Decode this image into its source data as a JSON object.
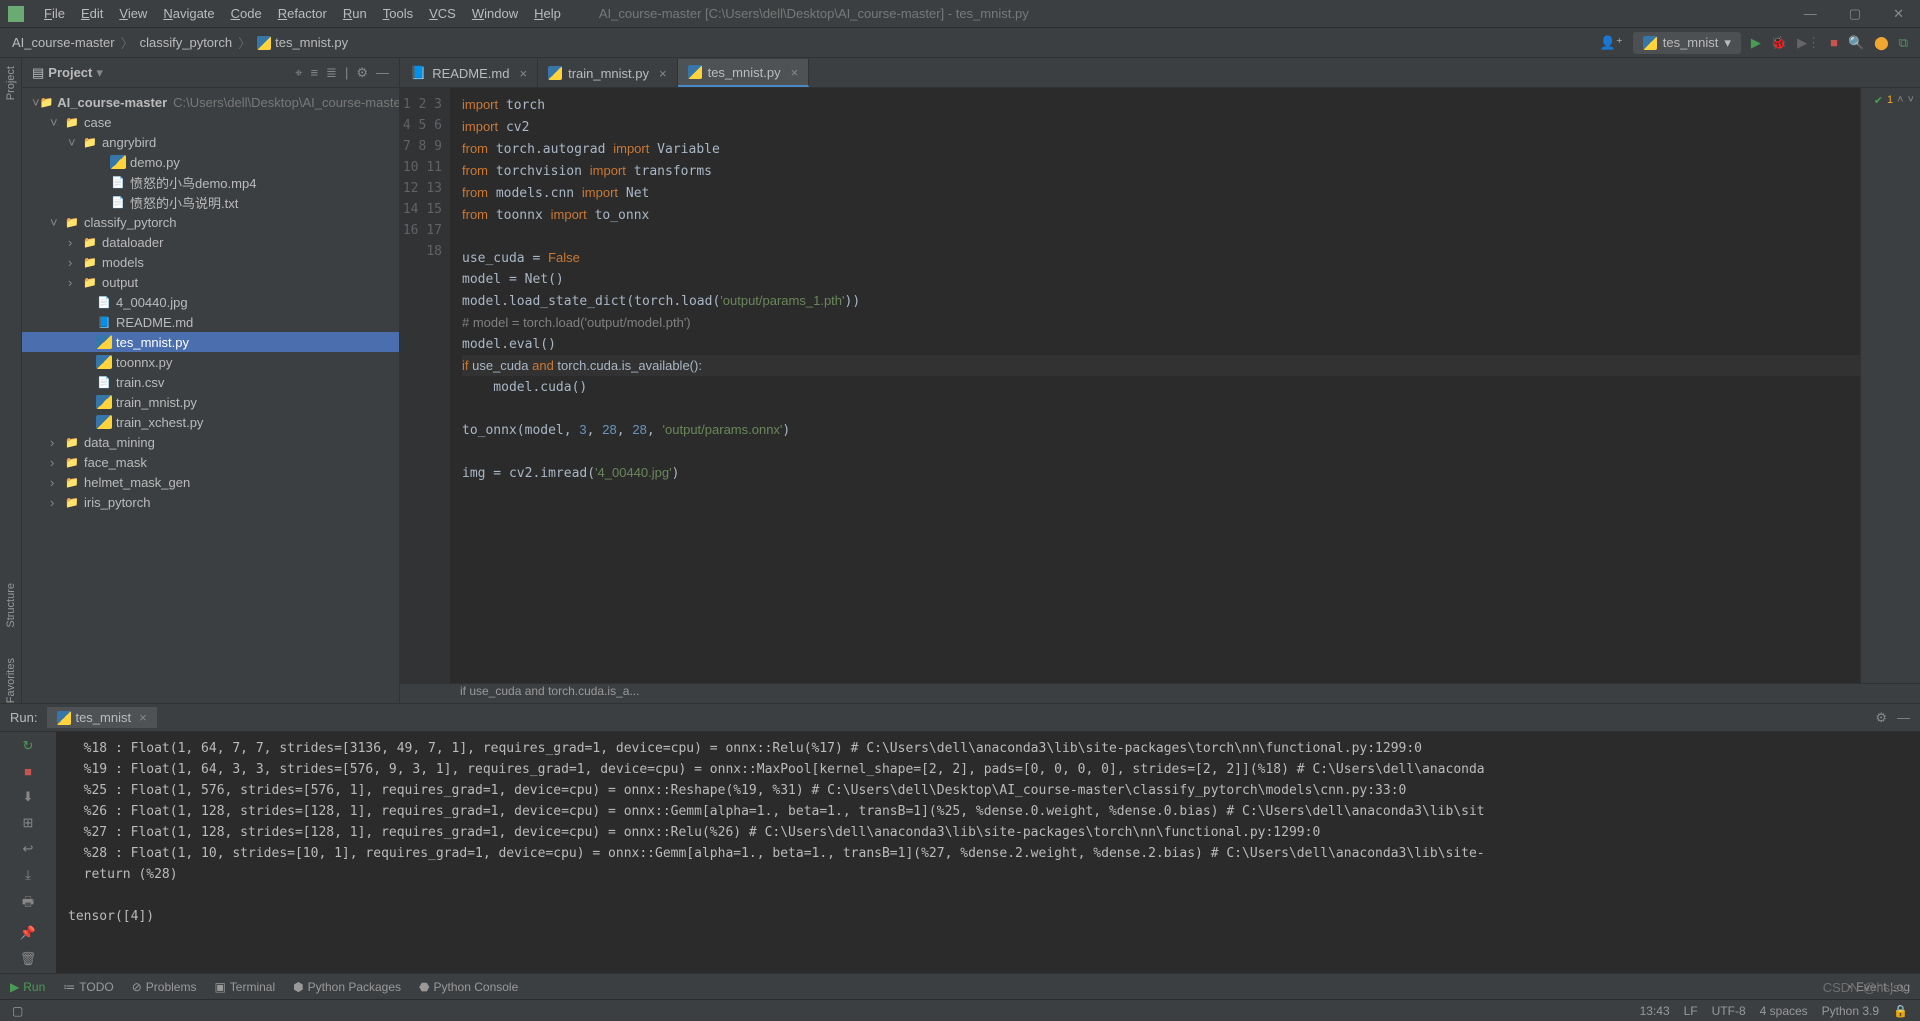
{
  "window": {
    "title_path": "AI_course-master [C:\\Users\\dell\\Desktop\\AI_course-master] - tes_mnist.py"
  },
  "menu": [
    "File",
    "Edit",
    "View",
    "Navigate",
    "Code",
    "Refactor",
    "Run",
    "Tools",
    "VCS",
    "Window",
    "Help"
  ],
  "breadcrumbs": [
    "AI_course-master",
    "classify_pytorch",
    "tes_mnist.py"
  ],
  "run_config": "tes_mnist",
  "project": {
    "title": "Project",
    "root_name": "AI_course-master",
    "root_path": "C:\\Users\\dell\\Desktop\\AI_course-master",
    "tree": [
      {
        "ind": 28,
        "tg": "˅",
        "ico": "fold",
        "label": "case"
      },
      {
        "ind": 46,
        "tg": "˅",
        "ico": "fold",
        "label": "angrybird"
      },
      {
        "ind": 74,
        "tg": "",
        "ico": "py",
        "label": "demo.py"
      },
      {
        "ind": 74,
        "tg": "",
        "ico": "file",
        "label": "愤怒的小鸟demo.mp4"
      },
      {
        "ind": 74,
        "tg": "",
        "ico": "file",
        "label": "愤怒的小鸟说明.txt"
      },
      {
        "ind": 28,
        "tg": "˅",
        "ico": "fold",
        "label": "classify_pytorch"
      },
      {
        "ind": 46,
        "tg": "›",
        "ico": "fold",
        "label": "dataloader"
      },
      {
        "ind": 46,
        "tg": "›",
        "ico": "fold",
        "label": "models"
      },
      {
        "ind": 46,
        "tg": "›",
        "ico": "fold",
        "label": "output"
      },
      {
        "ind": 60,
        "tg": "",
        "ico": "file",
        "label": "4_00440.jpg"
      },
      {
        "ind": 60,
        "tg": "",
        "ico": "md",
        "label": "README.md"
      },
      {
        "ind": 60,
        "tg": "",
        "ico": "py",
        "label": "tes_mnist.py",
        "sel": true
      },
      {
        "ind": 60,
        "tg": "",
        "ico": "py",
        "label": "toonnx.py"
      },
      {
        "ind": 60,
        "tg": "",
        "ico": "file",
        "label": "train.csv"
      },
      {
        "ind": 60,
        "tg": "",
        "ico": "py",
        "label": "train_mnist.py"
      },
      {
        "ind": 60,
        "tg": "",
        "ico": "py",
        "label": "train_xchest.py"
      },
      {
        "ind": 28,
        "tg": "›",
        "ico": "fold",
        "label": "data_mining"
      },
      {
        "ind": 28,
        "tg": "›",
        "ico": "fold",
        "label": "face_mask"
      },
      {
        "ind": 28,
        "tg": "›",
        "ico": "fold",
        "label": "helmet_mask_gen"
      },
      {
        "ind": 28,
        "tg": "›",
        "ico": "fold",
        "label": "iris_pytorch"
      }
    ]
  },
  "tabs": [
    {
      "label": "README.md",
      "ico": "md",
      "active": false
    },
    {
      "label": "train_mnist.py",
      "ico": "py",
      "active": false
    },
    {
      "label": "tes_mnist.py",
      "ico": "py",
      "active": true
    }
  ],
  "code_lines": [
    {
      "n": 1,
      "html": "<span class='kw'>import</span> torch"
    },
    {
      "n": 2,
      "html": "<span class='kw'>import</span> cv2"
    },
    {
      "n": 3,
      "html": "<span class='kw'>from</span> torch.autograd <span class='kw'>import</span> Variable"
    },
    {
      "n": 4,
      "html": "<span class='kw'>from</span> torchvision <span class='kw'>import</span> transforms"
    },
    {
      "n": 5,
      "html": "<span class='kw'>from</span> models.cnn <span class='kw'>import</span> Net"
    },
    {
      "n": 6,
      "html": "<span class='kw'>from</span> toonnx <span class='kw'>import</span> to_onnx"
    },
    {
      "n": 7,
      "html": ""
    },
    {
      "n": 8,
      "html": "use_cuda = <span class='kw'>False</span>"
    },
    {
      "n": 9,
      "html": "model = Net()"
    },
    {
      "n": 10,
      "html": "model.load_state_dict(torch.load(<span class='str'>'output/params_1.pth'</span>))"
    },
    {
      "n": 11,
      "html": "<span class='cmt'># model = torch.load('output/model.pth')</span>"
    },
    {
      "n": 12,
      "html": "model.eval()"
    },
    {
      "n": 13,
      "html": "<span class='kw'>if</span> use_cuda <span class='kw'>and</span> torch.cuda.is_available():",
      "hl": true
    },
    {
      "n": 14,
      "html": "    model.cuda()"
    },
    {
      "n": 15,
      "html": ""
    },
    {
      "n": 16,
      "html": "to_onnx(model, <span class='num'>3</span>, <span class='num'>28</span>, <span class='num'>28</span>, <span class='str'>'output/params.onnx'</span>)"
    },
    {
      "n": 17,
      "html": ""
    },
    {
      "n": 18,
      "html": "img = cv2.imread(<span class='str'>'4_00440.jpg'</span>)"
    }
  ],
  "code_crumb": "if use_cuda and torch.cuda.is_a...",
  "inspector": {
    "warn": "1"
  },
  "run": {
    "label": "Run:",
    "tab": "tes_mnist",
    "output": "  %18 : Float(1, 64, 7, 7, strides=[3136, 49, 7, 1], requires_grad=1, device=cpu) = onnx::Relu(%17) # C:\\Users\\dell\\anaconda3\\lib\\site-packages\\torch\\nn\\functional.py:1299:0\n  %19 : Float(1, 64, 3, 3, strides=[576, 9, 3, 1], requires_grad=1, device=cpu) = onnx::MaxPool[kernel_shape=[2, 2], pads=[0, 0, 0, 0], strides=[2, 2]](%18) # C:\\Users\\dell\\anaconda\n  %25 : Float(1, 576, strides=[576, 1], requires_grad=1, device=cpu) = onnx::Reshape(%19, %31) # C:\\Users\\dell\\Desktop\\AI_course-master\\classify_pytorch\\models\\cnn.py:33:0\n  %26 : Float(1, 128, strides=[128, 1], requires_grad=1, device=cpu) = onnx::Gemm[alpha=1., beta=1., transB=1](%25, %dense.0.weight, %dense.0.bias) # C:\\Users\\dell\\anaconda3\\lib\\sit\n  %27 : Float(1, 128, strides=[128, 1], requires_grad=1, device=cpu) = onnx::Relu(%26) # C:\\Users\\dell\\anaconda3\\lib\\site-packages\\torch\\nn\\functional.py:1299:0\n  %28 : Float(1, 10, strides=[10, 1], requires_grad=1, device=cpu) = onnx::Gemm[alpha=1., beta=1., transB=1](%27, %dense.2.weight, %dense.2.bias) # C:\\Users\\dell\\anaconda3\\lib\\site-\n  return (%28)\n\ntensor([4])"
  },
  "bottom_tools": [
    "Run",
    "TODO",
    "Problems",
    "Terminal",
    "Python Packages",
    "Python Console"
  ],
  "bottom_right": "Event Log",
  "status": {
    "pos": "13:43",
    "le": "LF",
    "enc": "UTF-8",
    "indent": "4 spaces",
    "interp": "Python 3.9"
  },
  "sidebar": {
    "left": [
      "Project",
      "Structure",
      "Favorites"
    ]
  },
  "watermark": "CSDN @hsjsv"
}
